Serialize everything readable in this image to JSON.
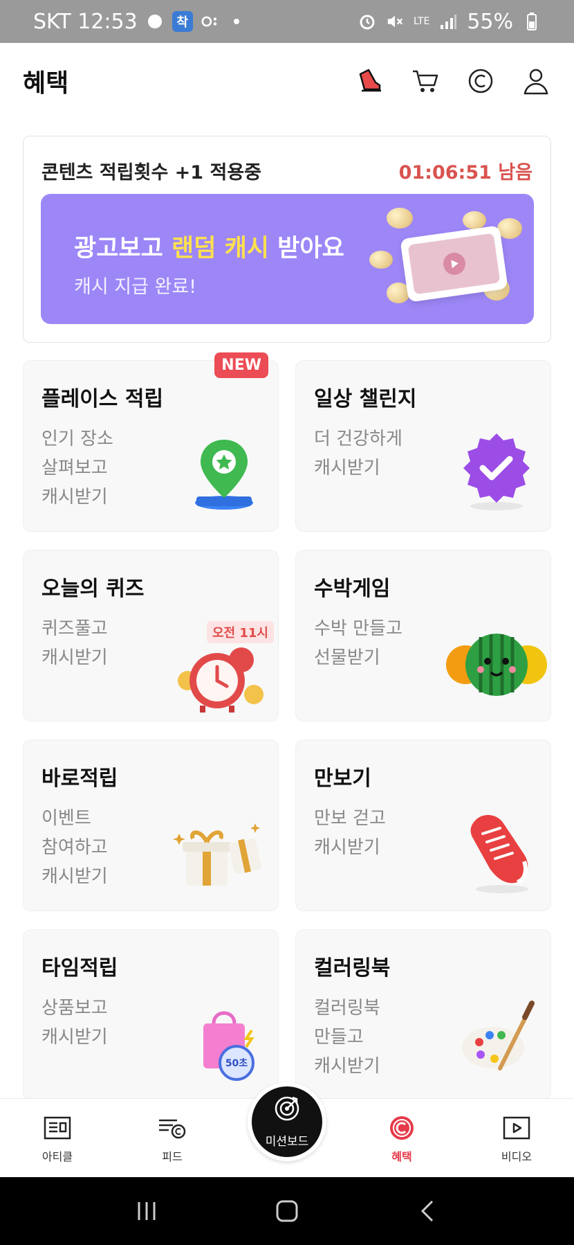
{
  "status_bar": {
    "carrier_time": "SKT 12:53",
    "app_badge": "착",
    "network": "LTE",
    "battery": "55%"
  },
  "header": {
    "title": "혜택"
  },
  "promo": {
    "title": "콘텐츠 적립횟수 +1 적용중",
    "timer": "01:06:51 남음",
    "banner_prefix": "광고보고 ",
    "banner_highlight": "랜덤 캐시",
    "banner_suffix": " 받아요",
    "banner_sub": "캐시 지급 완료!"
  },
  "cards": [
    {
      "title": "플레이스 적립",
      "lines": [
        "인기 장소",
        "살펴보고",
        "캐시받기"
      ],
      "badge": "NEW"
    },
    {
      "title": "일상 챌린지",
      "lines": [
        "더 건강하게",
        "캐시받기"
      ]
    },
    {
      "title": "오늘의 퀴즈",
      "lines": [
        "퀴즈풀고",
        "캐시받기"
      ],
      "time_badge": "오전 11시"
    },
    {
      "title": "수박게임",
      "lines": [
        "수박 만들고",
        "선물받기"
      ]
    },
    {
      "title": "바로적립",
      "lines": [
        "이벤트",
        "참여하고",
        "캐시받기"
      ]
    },
    {
      "title": "만보기",
      "lines": [
        "만보 걷고",
        "캐시받기"
      ]
    },
    {
      "title": "타임적립",
      "lines": [
        "상품보고",
        "캐시받기"
      ],
      "timer_badge": "50초"
    },
    {
      "title": "컬러링북",
      "lines": [
        "컬러링북",
        "만들고",
        "캐시받기"
      ]
    }
  ],
  "bottom_nav": {
    "items": [
      {
        "label": "아티클"
      },
      {
        "label": "피드"
      },
      {
        "label": "미션보드"
      },
      {
        "label": "혜택"
      },
      {
        "label": "비디오"
      }
    ]
  },
  "colors": {
    "accent": "#e53a4a",
    "banner": "#9d87f7",
    "highlight": "#ffe14d"
  }
}
